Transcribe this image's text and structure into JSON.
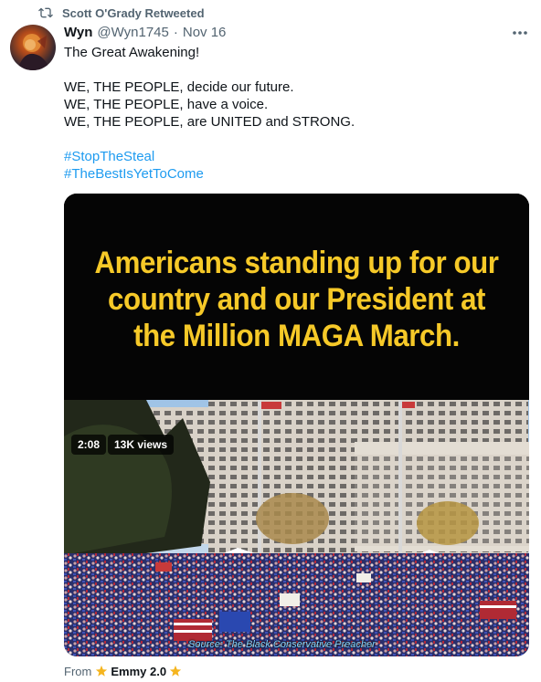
{
  "retweet": {
    "label": "Scott O'Grady Retweeted",
    "icon": "retweet-icon"
  },
  "author": {
    "display_name": "Wyn",
    "handle": "@Wyn1745",
    "separator": "·",
    "date": "Nov 16",
    "avatar_icon": "avatar"
  },
  "more_icon": "more-options-icon",
  "tweet": {
    "line1": "The Great Awakening!",
    "line2": "WE, THE PEOPLE, decide our future.",
    "line3": "WE, THE PEOPLE, have a voice.",
    "line4": "WE, THE PEOPLE, are UNITED and STRONG.",
    "hashtag1": "#StopTheSteal",
    "hashtag2": "#TheBestIsYetToCome"
  },
  "media": {
    "banner_line1": "Americans standing up for our",
    "banner_line2": "country and our President at",
    "banner_line3": "the Million MAGA March.",
    "duration": "2:08",
    "views": "13K views",
    "caption": "Source: The Black Conservative Preacher"
  },
  "footer": {
    "from_label": "From",
    "app_name": "Emmy 2.0",
    "star_icon": "star-icon"
  },
  "colors": {
    "link": "#1d9bf0",
    "muted": "#536471",
    "banner_text": "#f6c928"
  }
}
